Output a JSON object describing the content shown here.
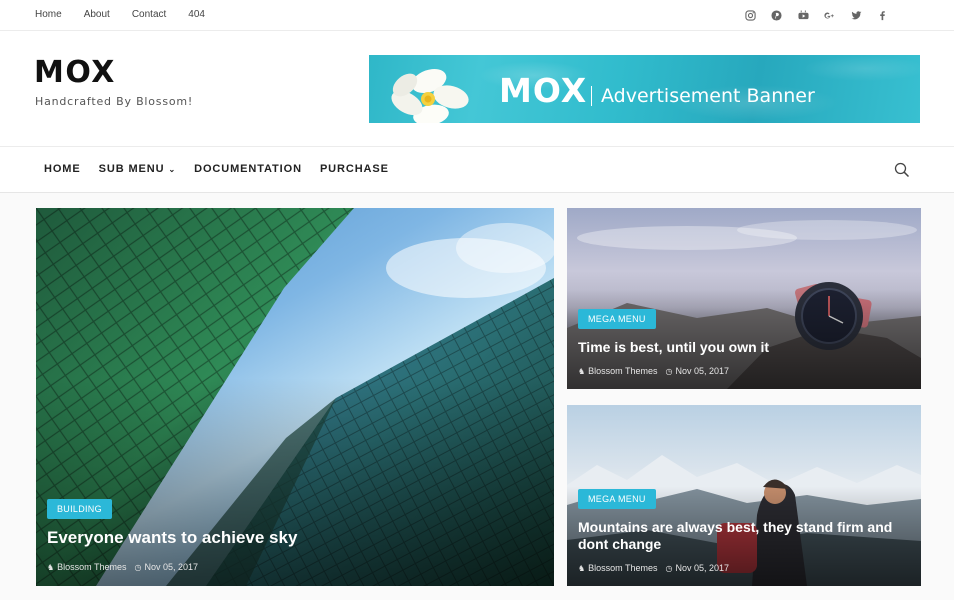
{
  "topnav": [
    "Home",
    "About",
    "Contact",
    "404"
  ],
  "social_icons": [
    "instagram-icon",
    "pinterest-icon",
    "youtube-icon",
    "google-plus-icon",
    "twitter-icon",
    "facebook-icon"
  ],
  "site": {
    "title": "MOX",
    "tagline": "Handcrafted By Blossom!"
  },
  "banner": {
    "brand": "MOX",
    "text": "Advertisement Banner"
  },
  "menu": [
    {
      "label": "HOME"
    },
    {
      "label": "SUB MENU"
    },
    {
      "label": "DOCUMENTATION"
    },
    {
      "label": "PURCHASE"
    }
  ],
  "posts": [
    {
      "category": "BUILDING",
      "title": "Everyone wants to achieve sky",
      "author": "Blossom Themes",
      "date": "Nov 05, 2017"
    },
    {
      "category": "MEGA MENU",
      "title": "Time is best, until you own it",
      "author": "Blossom Themes",
      "date": "Nov 05, 2017"
    },
    {
      "category": "MEGA MENU",
      "title": "Mountains are always best, they stand firm and dont change",
      "author": "Blossom Themes",
      "date": "Nov 05, 2017"
    }
  ],
  "colors": {
    "accent": "#2bb8d8",
    "banner": "#2fb7c8"
  }
}
